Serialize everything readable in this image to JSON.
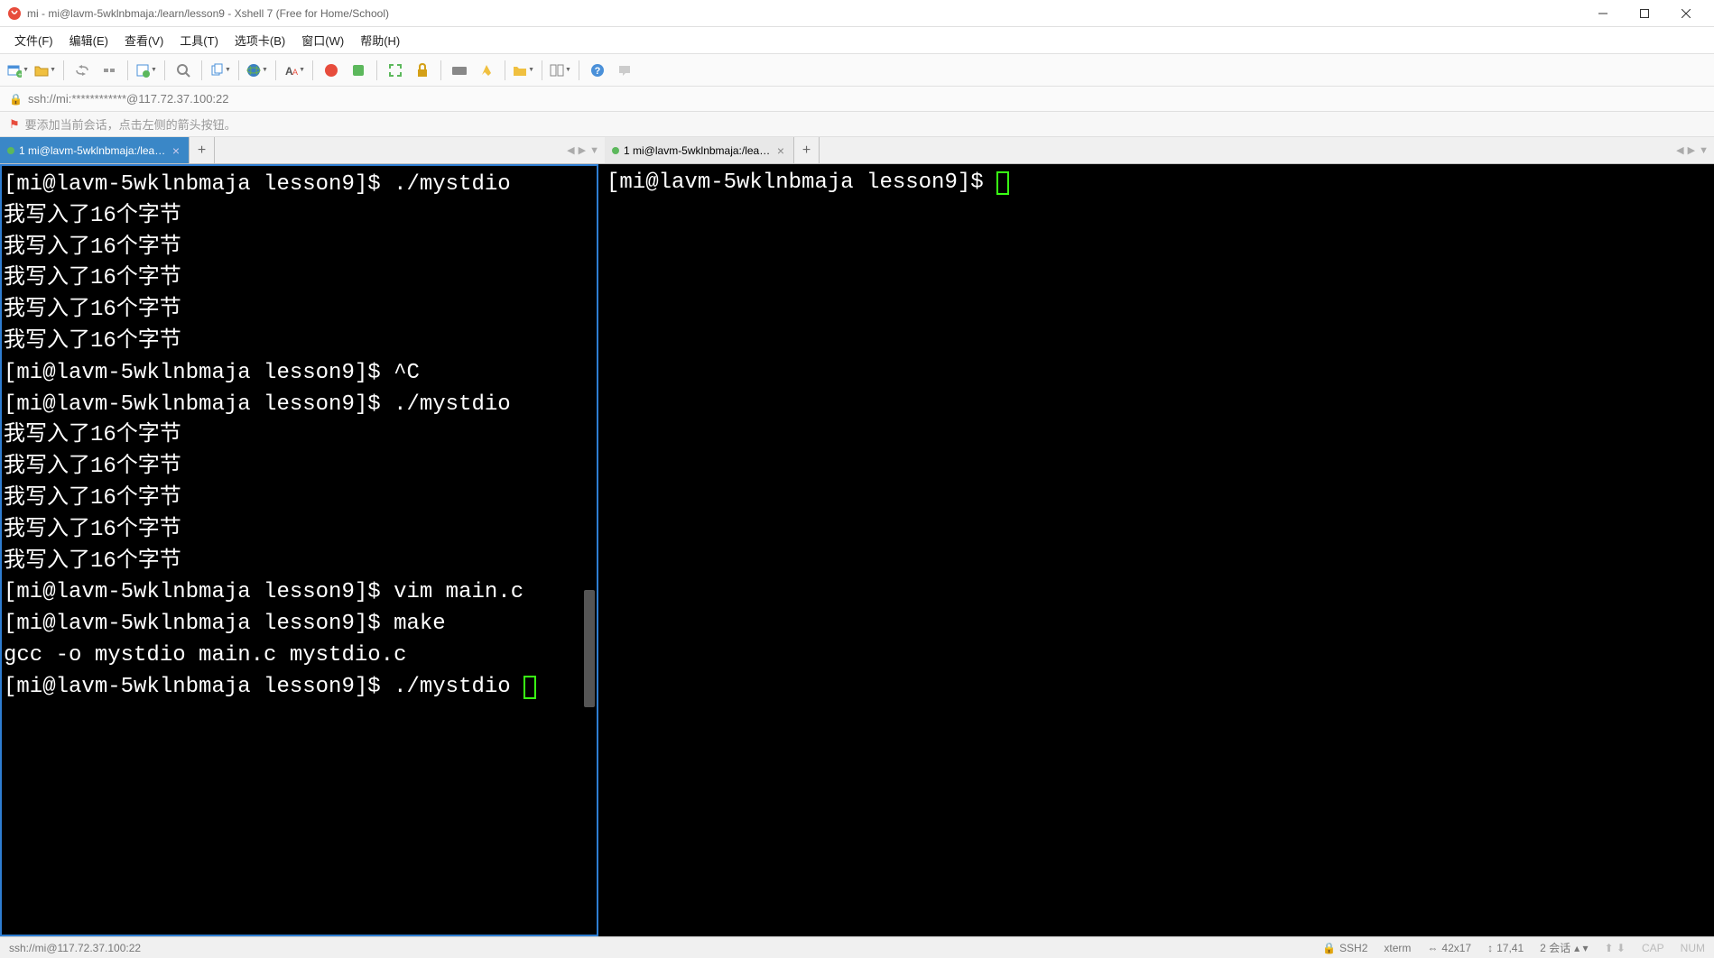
{
  "titlebar": {
    "title": "mi - mi@lavm-5wklnbmaja:/learn/lesson9 - Xshell 7 (Free for Home/School)"
  },
  "menubar": {
    "items": [
      "文件(F)",
      "编辑(E)",
      "查看(V)",
      "工具(T)",
      "选项卡(B)",
      "窗口(W)",
      "帮助(H)"
    ]
  },
  "addressbar": {
    "text": "ssh://mi:************@117.72.37.100:22"
  },
  "hintbar": {
    "text": "要添加当前会话，点击左侧的箭头按钮。"
  },
  "tabs": {
    "left": {
      "label": "1 mi@lavm-5wklnbmaja:/learn..."
    },
    "right": {
      "label": "1 mi@lavm-5wklnbmaja:/learn..."
    }
  },
  "terminal_left": {
    "lines": [
      "[mi@lavm-5wklnbmaja lesson9]$ ./mystdio",
      "我写入了16个字节",
      "我写入了16个字节",
      "我写入了16个字节",
      "我写入了16个字节",
      "我写入了16个字节",
      "[mi@lavm-5wklnbmaja lesson9]$ ^C",
      "[mi@lavm-5wklnbmaja lesson9]$ ./mystdio",
      "我写入了16个字节",
      "我写入了16个字节",
      "我写入了16个字节",
      "我写入了16个字节",
      "我写入了16个字节",
      "[mi@lavm-5wklnbmaja lesson9]$ vim main.c",
      "[mi@lavm-5wklnbmaja lesson9]$ make",
      "gcc -o mystdio main.c mystdio.c",
      "[mi@lavm-5wklnbmaja lesson9]$ ./mystdio "
    ]
  },
  "terminal_right": {
    "prompt": "[mi@lavm-5wklnbmaja lesson9]$ "
  },
  "statusbar": {
    "left": "ssh://mi@117.72.37.100:22",
    "proto": "SSH2",
    "termtype": "xterm",
    "dims": "42x17",
    "size": "17,41",
    "sessions": "2 会话",
    "cap": "CAP",
    "num": "NUM"
  }
}
